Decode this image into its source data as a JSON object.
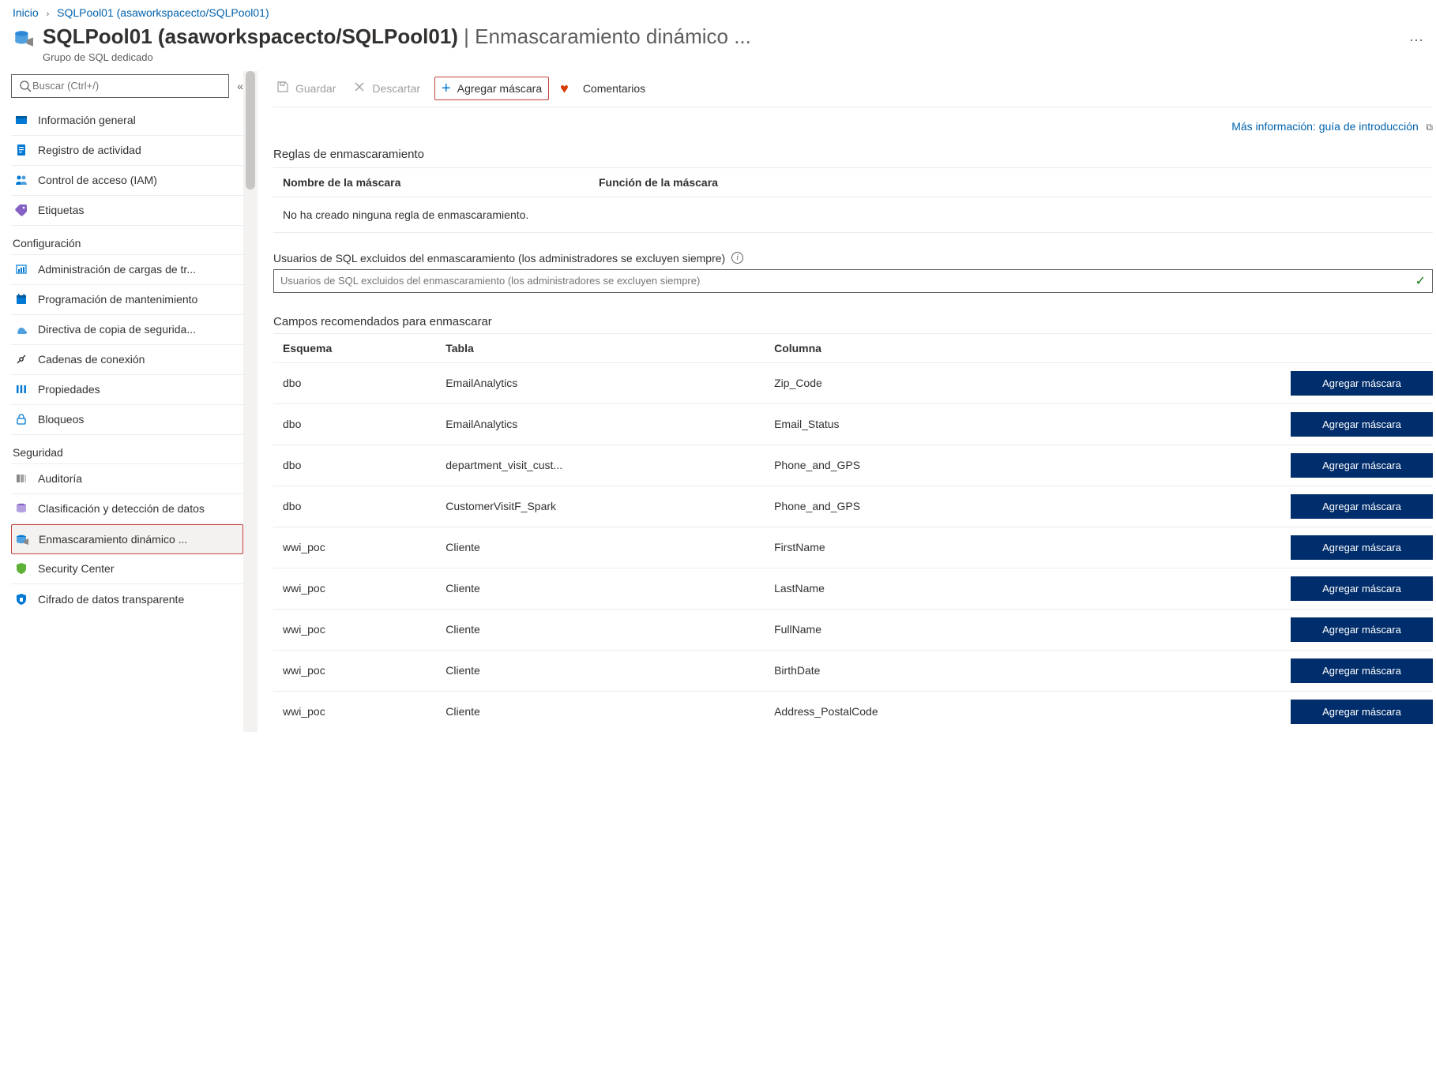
{
  "breadcrumb": {
    "home": "Inicio",
    "resource": "SQLPool01 (asaworkspacecto/SQLPool01)"
  },
  "header": {
    "title_strong": "SQLPool01 (asaworkspacecto/SQLPool01)",
    "title_sep": " | ",
    "title_thin": "Enmascaramiento dinámico ...",
    "subtitle": "Grupo de SQL dedicado"
  },
  "sidebar": {
    "search_placeholder": "Buscar (Ctrl+/)",
    "items": [
      {
        "label": "Información general",
        "icon": "overview"
      },
      {
        "label": "Registro de actividad",
        "icon": "log"
      },
      {
        "label": "Control de acceso (IAM)",
        "icon": "iam"
      },
      {
        "label": "Etiquetas",
        "icon": "tag"
      }
    ],
    "section1": "Configuración",
    "config_items": [
      {
        "label": "Administración de cargas de tr...",
        "icon": "workload"
      },
      {
        "label": "Programación de mantenimiento",
        "icon": "schedule"
      },
      {
        "label": "Directiva de copia de segurida...",
        "icon": "backup"
      },
      {
        "label": "Cadenas de conexión",
        "icon": "conn"
      },
      {
        "label": "Propiedades",
        "icon": "props"
      },
      {
        "label": "Bloqueos",
        "icon": "lock"
      }
    ],
    "section2": "Seguridad",
    "security_items": [
      {
        "label": "Auditoría",
        "icon": "audit"
      },
      {
        "label": "Clasificación y detección de datos",
        "icon": "classify"
      },
      {
        "label": "Enmascaramiento dinámico ...",
        "icon": "mask",
        "selected": true
      },
      {
        "label": "Security Center",
        "icon": "shield"
      },
      {
        "label": "Cifrado de datos transparente",
        "icon": "tde"
      }
    ]
  },
  "toolbar": {
    "save": "Guardar",
    "discard": "Descartar",
    "add_mask": "Agregar máscara",
    "feedback": "Comentarios"
  },
  "more_info": "Más información: guía de introducción",
  "rules": {
    "title": "Reglas de enmascaramiento",
    "col1": "Nombre de la máscara",
    "col2": "Función de la máscara",
    "empty": "No ha creado ninguna regla de enmascaramiento."
  },
  "excluded": {
    "label": "Usuarios de SQL excluidos del enmascaramiento (los administradores se excluyen siempre)",
    "placeholder": "Usuarios de SQL excluidos del enmascaramiento (los administradores se excluyen siempre)"
  },
  "recs": {
    "title": "Campos recomendados para enmascarar",
    "col_schema": "Esquema",
    "col_table": "Tabla",
    "col_column": "Columna",
    "add_btn": "Agregar máscara",
    "rows": [
      {
        "schema": "dbo",
        "table": "EmailAnalytics",
        "column": "Zip_Code"
      },
      {
        "schema": "dbo",
        "table": "EmailAnalytics",
        "column": "Email_Status"
      },
      {
        "schema": "dbo",
        "table": "department_visit_cust...",
        "column": "Phone_and_GPS"
      },
      {
        "schema": "dbo",
        "table": "CustomerVisitF_Spark",
        "column": "Phone_and_GPS"
      },
      {
        "schema": "wwi_poc",
        "table": "Cliente",
        "column": "FirstName"
      },
      {
        "schema": "wwi_poc",
        "table": "Cliente",
        "column": "LastName"
      },
      {
        "schema": "wwi_poc",
        "table": "Cliente",
        "column": "FullName"
      },
      {
        "schema": "wwi_poc",
        "table": "Cliente",
        "column": "BirthDate"
      },
      {
        "schema": "wwi_poc",
        "table": "Cliente",
        "column": "Address_PostalCode"
      }
    ]
  }
}
